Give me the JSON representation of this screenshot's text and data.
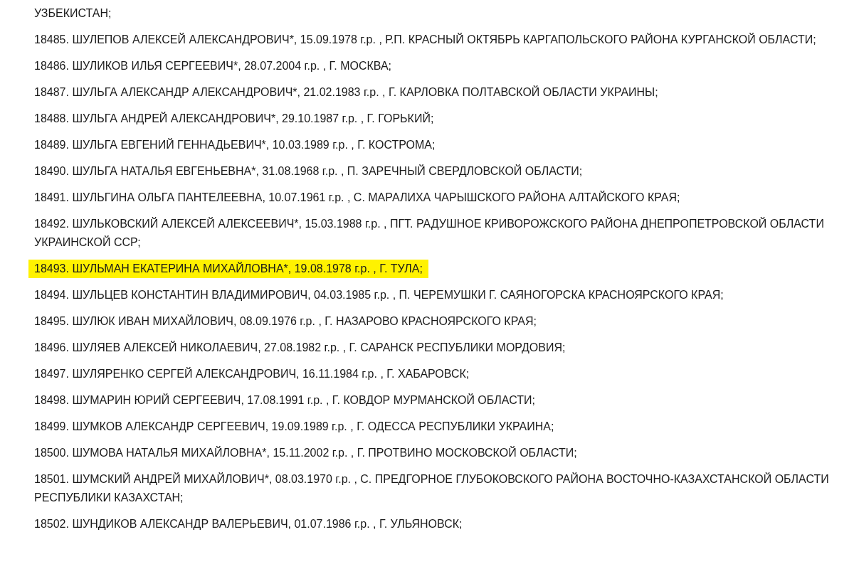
{
  "entries": [
    {
      "text": "УЗБЕКИСТАН;",
      "highlighted": false
    },
    {
      "text": "18485. ШУЛЕПОВ АЛЕКСЕЙ АЛЕКСАНДРОВИЧ*, 15.09.1978 г.р. , Р.П. КРАСНЫЙ ОКТЯБРЬ КАРГАПОЛЬСКОГО РАЙОНА КУРГАНСКОЙ ОБЛАСТИ;",
      "highlighted": false
    },
    {
      "text": "18486. ШУЛИКОВ ИЛЬЯ СЕРГЕЕВИЧ*, 28.07.2004 г.р. , Г. МОСКВА;",
      "highlighted": false
    },
    {
      "text": "18487. ШУЛЬГА АЛЕКСАНДР АЛЕКСАНДРОВИЧ*, 21.02.1983 г.р. , Г. КАРЛОВКА ПОЛТАВСКОЙ ОБЛАСТИ УКРАИНЫ;",
      "highlighted": false
    },
    {
      "text": "18488. ШУЛЬГА АНДРЕЙ АЛЕКСАНДРОВИЧ*, 29.10.1987 г.р. , Г. ГОРЬКИЙ;",
      "highlighted": false
    },
    {
      "text": "18489. ШУЛЬГА ЕВГЕНИЙ ГЕННАДЬЕВИЧ*, 10.03.1989 г.р. , Г. КОСТРОМА;",
      "highlighted": false
    },
    {
      "text": "18490. ШУЛЬГА НАТАЛЬЯ ЕВГЕНЬЕВНА*, 31.08.1968 г.р. , П. ЗАРЕЧНЫЙ СВЕРДЛОВСКОЙ ОБЛАСТИ;",
      "highlighted": false
    },
    {
      "text": "18491. ШУЛЬГИНА ОЛЬГА ПАНТЕЛЕЕВНА, 10.07.1961 г.р. , С. МАРАЛИХА ЧАРЫШСКОГО РАЙОНА АЛТАЙСКОГО КРАЯ;",
      "highlighted": false
    },
    {
      "text": "18492. ШУЛЬКОВСКИЙ АЛЕКСЕЙ АЛЕКСЕЕВИЧ*, 15.03.1988 г.р. , ПГТ. РАДУШНОЕ КРИВОРОЖСКОГО РАЙОНА ДНЕПРОПЕТРОВСКОЙ ОБЛАСТИ УКРАИНСКОЙ ССР;",
      "highlighted": false
    },
    {
      "text": "18493. ШУЛЬМАН ЕКАТЕРИНА МИХАЙЛОВНА*, 19.08.1978 г.р. , Г. ТУЛА;",
      "highlighted": true
    },
    {
      "text": "18494. ШУЛЬЦЕВ КОНСТАНТИН ВЛАДИМИРОВИЧ, 04.03.1985 г.р. , П. ЧЕРЕМУШКИ Г. САЯНОГОРСКА КРАСНОЯРСКОГО КРАЯ;",
      "highlighted": false
    },
    {
      "text": "18495. ШУЛЮК ИВАН МИХАЙЛОВИЧ, 08.09.1976 г.р. , Г. НАЗАРОВО КРАСНОЯРСКОГО КРАЯ;",
      "highlighted": false
    },
    {
      "text": "18496. ШУЛЯЕВ АЛЕКСЕЙ НИКОЛАЕВИЧ, 27.08.1982 г.р. , Г. САРАНСК РЕСПУБЛИКИ МОРДОВИЯ;",
      "highlighted": false
    },
    {
      "text": "18497. ШУЛЯРЕНКО СЕРГЕЙ АЛЕКСАНДРОВИЧ, 16.11.1984 г.р. , Г. ХАБАРОВСК;",
      "highlighted": false
    },
    {
      "text": "18498. ШУМАРИН ЮРИЙ СЕРГЕЕВИЧ, 17.08.1991 г.р. , Г. КОВДОР МУРМАНСКОЙ ОБЛАСТИ;",
      "highlighted": false
    },
    {
      "text": "18499. ШУМКОВ АЛЕКСАНДР СЕРГЕЕВИЧ, 19.09.1989 г.р. , Г. ОДЕССА РЕСПУБЛИКИ УКРАИНА;",
      "highlighted": false
    },
    {
      "text": "18500. ШУМОВА НАТАЛЬЯ МИХАЙЛОВНА*, 15.11.2002 г.р. , Г. ПРОТВИНО МОСКОВСКОЙ ОБЛАСТИ;",
      "highlighted": false
    },
    {
      "text": "18501. ШУМСКИЙ АНДРЕЙ МИХАЙЛОВИЧ*, 08.03.1970 г.р. , С. ПРЕДГОРНОЕ ГЛУБОКОВСКОГО РАЙОНА ВОСТОЧНО-КАЗАХСТАНСКОЙ ОБЛАСТИ РЕСПУБЛИКИ КАЗАХСТАН;",
      "highlighted": false
    },
    {
      "text": "18502. ШУНДИКОВ АЛЕКСАНДР ВАЛЕРЬЕВИЧ, 01.07.1986 г.р. , Г. УЛЬЯНОВСК;",
      "highlighted": false
    }
  ]
}
